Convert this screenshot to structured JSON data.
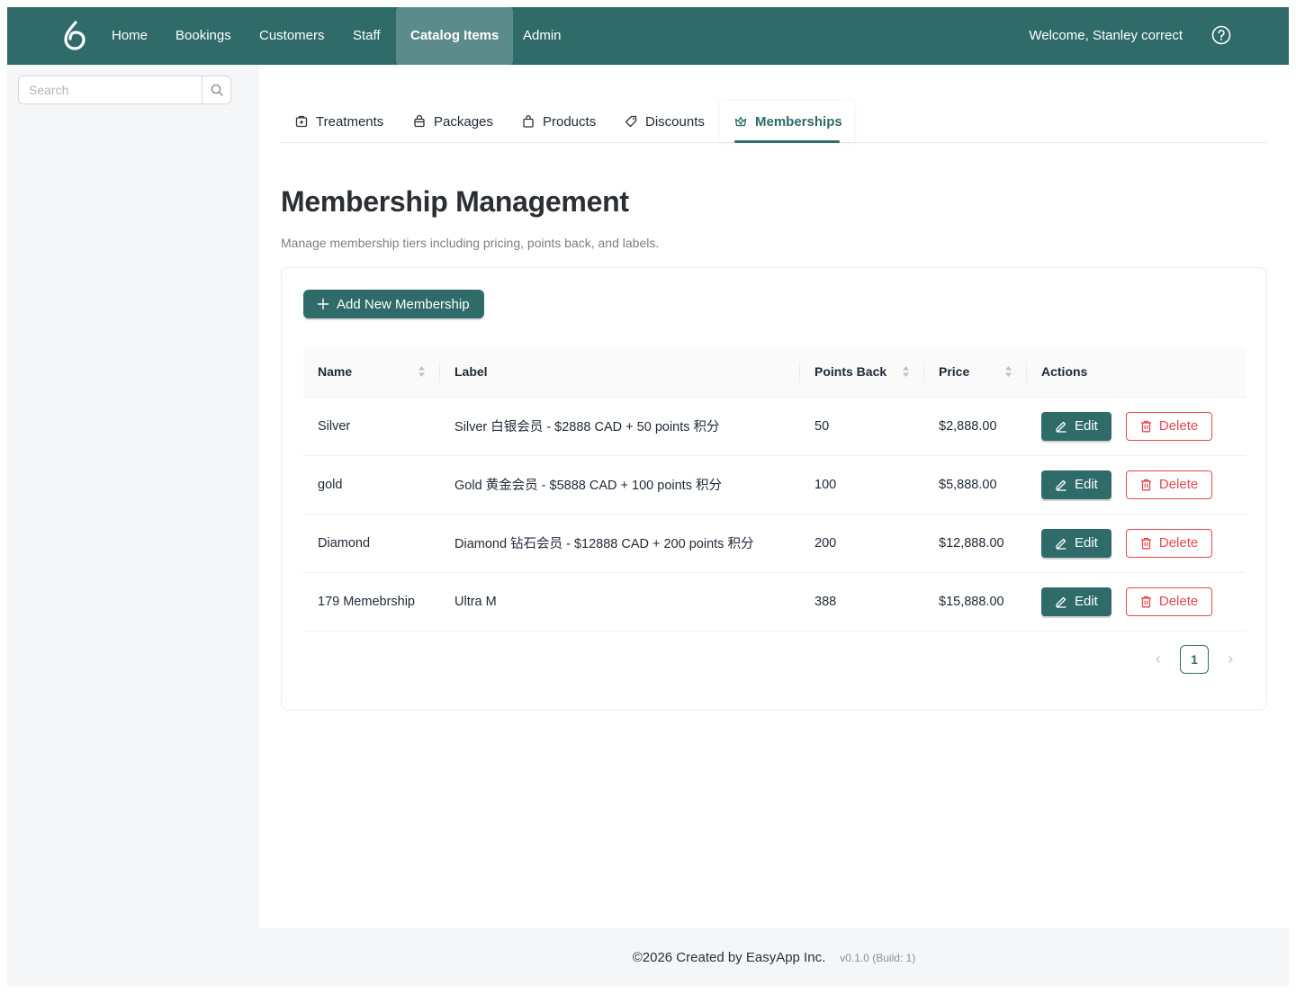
{
  "nav": {
    "items": [
      {
        "label": "Home"
      },
      {
        "label": "Bookings"
      },
      {
        "label": "Customers"
      },
      {
        "label": "Staff"
      },
      {
        "label": "Catalog Items",
        "active": true
      },
      {
        "label": "Admin"
      }
    ],
    "welcome": "Welcome, Stanley correct",
    "help_icon": "question-circle-icon",
    "logo_icon": "brand-logo-icon"
  },
  "sidebar": {
    "search_placeholder": "Search",
    "search_value": ""
  },
  "tabs": [
    {
      "label": "Treatments",
      "icon": "treatment-icon"
    },
    {
      "label": "Packages",
      "icon": "package-icon"
    },
    {
      "label": "Products",
      "icon": "shopping-bag-icon"
    },
    {
      "label": "Discounts",
      "icon": "tag-icon"
    },
    {
      "label": "Memberships",
      "icon": "crown-icon",
      "active": true
    }
  ],
  "page": {
    "title": "Membership Management",
    "subtitle": "Manage membership tiers including pricing, points back, and labels."
  },
  "toolbar": {
    "add_label": "Add New Membership"
  },
  "table": {
    "columns": [
      "Name",
      "Label",
      "Points Back",
      "Price",
      "Actions"
    ],
    "rows": [
      {
        "name": "Silver",
        "label": "Silver 白银会员 - $2888 CAD + 50 points 积分",
        "points": "50",
        "price": "$2,888.00"
      },
      {
        "name": "gold",
        "label": "Gold 黄金会员 - $5888 CAD + 100 points 积分",
        "points": "100",
        "price": "$5,888.00"
      },
      {
        "name": "Diamond",
        "label": "Diamond 钻石会员 - $12888 CAD + 200 points 积分",
        "points": "200",
        "price": "$12,888.00"
      },
      {
        "name": "179 Memebrship",
        "label": "Ultra M",
        "points": "388",
        "price": "$15,888.00"
      }
    ],
    "edit_label": "Edit",
    "delete_label": "Delete"
  },
  "pagination": {
    "current_page": "1"
  },
  "footer": {
    "copyright": "©2026 Created by EasyApp Inc.",
    "version": "v0.1.0 (Build: 1)"
  },
  "colors": {
    "brand": "#2e6b69",
    "danger": "#e5484d"
  }
}
